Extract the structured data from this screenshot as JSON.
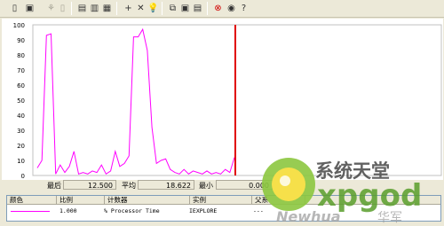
{
  "toolbar": {
    "icons": [
      "new-counter-set-icon",
      "clear-display-icon",
      "view-current-activity-icon",
      "view-log-data-icon",
      "view-graph-icon",
      "view-histogram-icon",
      "view-report-icon",
      "add-counter-icon",
      "delete-counter-icon",
      "highlight-icon",
      "copy-properties-icon",
      "paste-counter-list-icon",
      "properties-icon",
      "freeze-display-icon",
      "update-data-icon",
      "help-icon"
    ]
  },
  "chart_data": {
    "type": "line",
    "ylim": [
      0,
      100
    ],
    "yticks": [
      "100",
      "90",
      "80",
      "70",
      "60",
      "50",
      "40",
      "30",
      "20",
      "10",
      "0"
    ],
    "series": [
      {
        "values": [
          5,
          10,
          93,
          94,
          1,
          7,
          2,
          6,
          16,
          1,
          2,
          1,
          3,
          2,
          7,
          1,
          3,
          16,
          6,
          8,
          13,
          92,
          92,
          97,
          83,
          32,
          8,
          10,
          11,
          4,
          2,
          1,
          4,
          1,
          3,
          2,
          1,
          3,
          1,
          2,
          1,
          4,
          2,
          12
        ]
      }
    ],
    "cursor_index": 43,
    "line_color": "#ff00ff",
    "cursor_color": "#e00000"
  },
  "stats": {
    "last_label": "最后",
    "last_value": "12.500",
    "avg_label": "平均",
    "avg_value": "18.622",
    "min_label": "最小",
    "min_value": "0.000"
  },
  "legend": {
    "headers": {
      "color": "颜色",
      "scale": "比例",
      "counter": "计数器",
      "instance": "实例",
      "parent": "父系"
    },
    "rows": [
      {
        "scale": "1.000",
        "counter": "% Processor Time",
        "instance": "IEXPLORE",
        "parent": "---",
        "color": "#ff00ff"
      }
    ]
  },
  "watermark": {
    "brand_cn": "系统天堂",
    "brand_en": "xpgod",
    "sub_en": "Newhua",
    "sub_cn": "华军"
  }
}
